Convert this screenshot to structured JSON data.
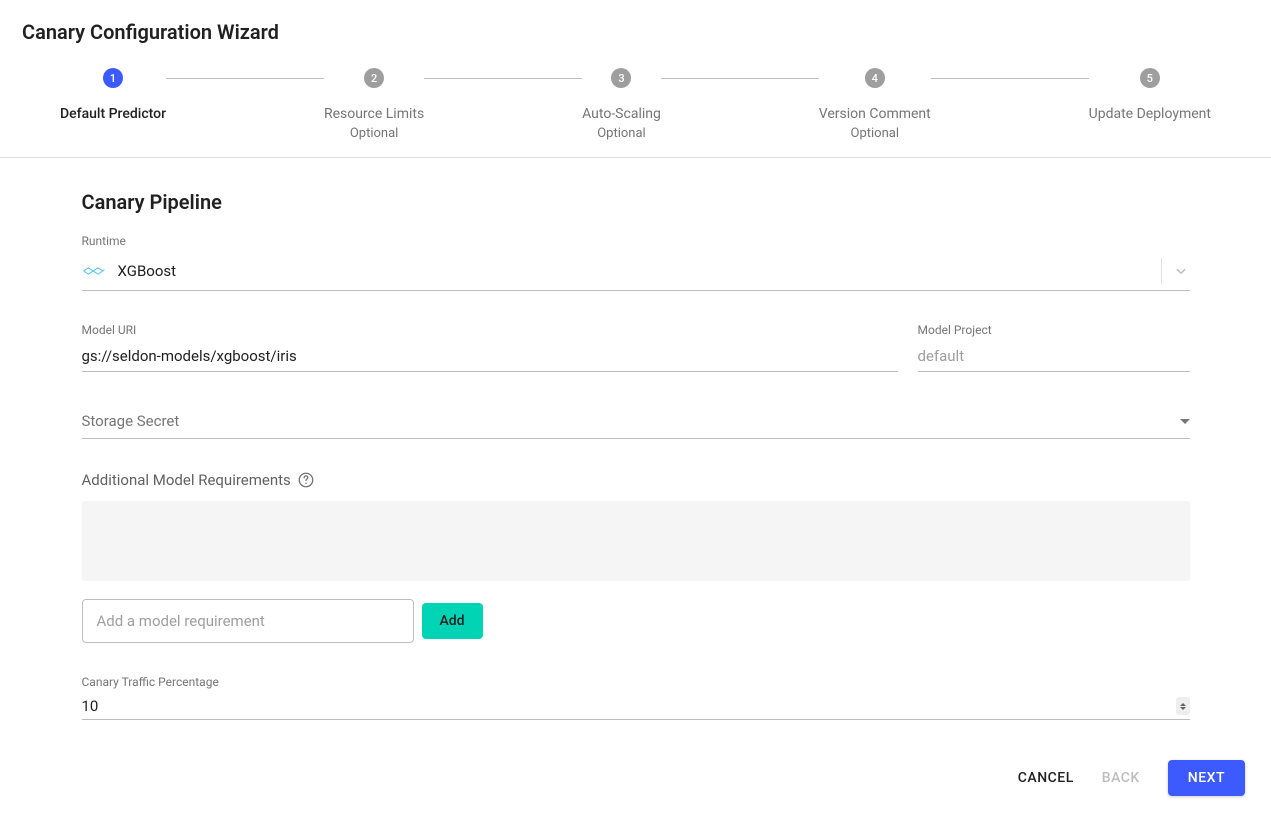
{
  "page_title": "Canary Configuration Wizard",
  "stepper": [
    {
      "num": "1",
      "label": "Default Predictor",
      "optional": "",
      "active": true
    },
    {
      "num": "2",
      "label": "Resource Limits",
      "optional": "Optional",
      "active": false
    },
    {
      "num": "3",
      "label": "Auto-Scaling",
      "optional": "Optional",
      "active": false
    },
    {
      "num": "4",
      "label": "Version Comment",
      "optional": "Optional",
      "active": false
    },
    {
      "num": "5",
      "label": "Update Deployment",
      "optional": "",
      "active": false
    }
  ],
  "section_title": "Canary Pipeline",
  "runtime": {
    "label": "Runtime",
    "value": "XGBoost"
  },
  "model_uri": {
    "label": "Model URI",
    "value": "gs://seldon-models/xgboost/iris"
  },
  "model_project": {
    "label": "Model Project",
    "placeholder": "default",
    "value": ""
  },
  "storage_secret": {
    "placeholder": "Storage Secret"
  },
  "additional_req": {
    "label": "Additional Model Requirements",
    "input_placeholder": "Add a model requirement",
    "add_btn": "Add"
  },
  "traffic": {
    "label": "Canary Traffic Percentage",
    "value": "10"
  },
  "footer": {
    "cancel": "CANCEL",
    "back": "BACK",
    "next": "NEXT"
  }
}
